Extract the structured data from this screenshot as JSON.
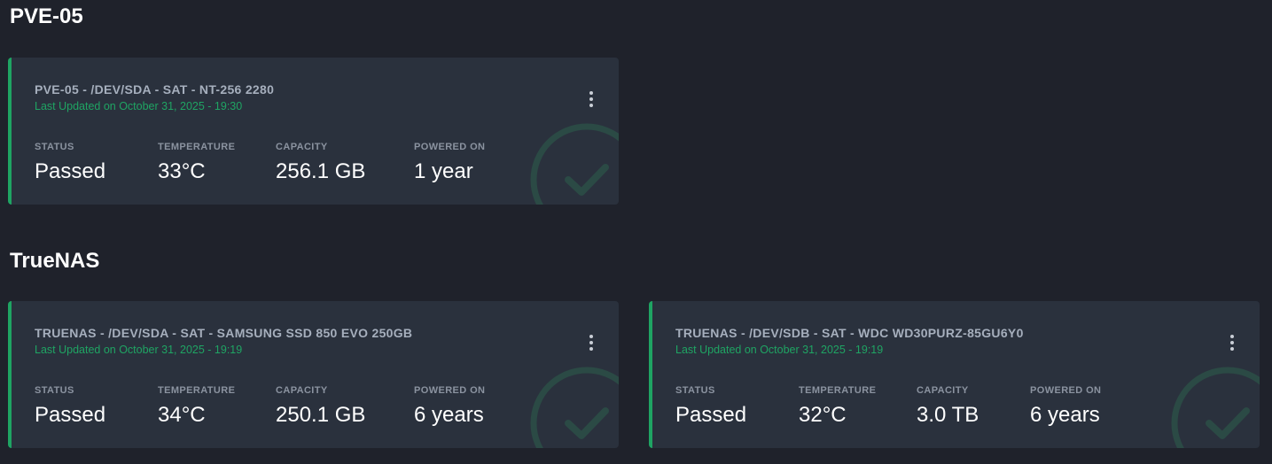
{
  "colors": {
    "background": "#1f222b",
    "card": "#2a313d",
    "accent_green": "#1fa463",
    "label_gray": "#8b93a0"
  },
  "groups": [
    {
      "title": "PVE-05",
      "cards": [
        {
          "title": "PVE-05 - /DEV/SDA - SAT - NT-256 2280",
          "updated": "Last Updated on October 31, 2025 - 19:30",
          "stats": {
            "status_label": "STATUS",
            "status": "Passed",
            "temperature_label": "TEMPERATURE",
            "temperature": "33°C",
            "capacity_label": "CAPACITY",
            "capacity": "256.1 GB",
            "powered_on_label": "POWERED ON",
            "powered_on": "1 year"
          },
          "menu_icon": "more-vertical-icon",
          "status_icon": "check-circle-icon"
        }
      ]
    },
    {
      "title": "TrueNAS",
      "cards": [
        {
          "title": "TRUENAS - /DEV/SDA - SAT - SAMSUNG SSD 850 EVO 250GB",
          "updated": "Last Updated on October 31, 2025 - 19:19",
          "stats": {
            "status_label": "STATUS",
            "status": "Passed",
            "temperature_label": "TEMPERATURE",
            "temperature": "34°C",
            "capacity_label": "CAPACITY",
            "capacity": "250.1 GB",
            "powered_on_label": "POWERED ON",
            "powered_on": "6 years"
          },
          "menu_icon": "more-vertical-icon",
          "status_icon": "check-circle-icon"
        },
        {
          "title": "TRUENAS - /DEV/SDB - SAT - WDC WD30PURZ-85GU6Y0",
          "updated": "Last Updated on October 31, 2025 - 19:19",
          "stats": {
            "status_label": "STATUS",
            "status": "Passed",
            "temperature_label": "TEMPERATURE",
            "temperature": "32°C",
            "capacity_label": "CAPACITY",
            "capacity": "3.0 TB",
            "powered_on_label": "POWERED ON",
            "powered_on": "6 years"
          },
          "menu_icon": "more-vertical-icon",
          "status_icon": "check-circle-icon"
        }
      ]
    }
  ]
}
